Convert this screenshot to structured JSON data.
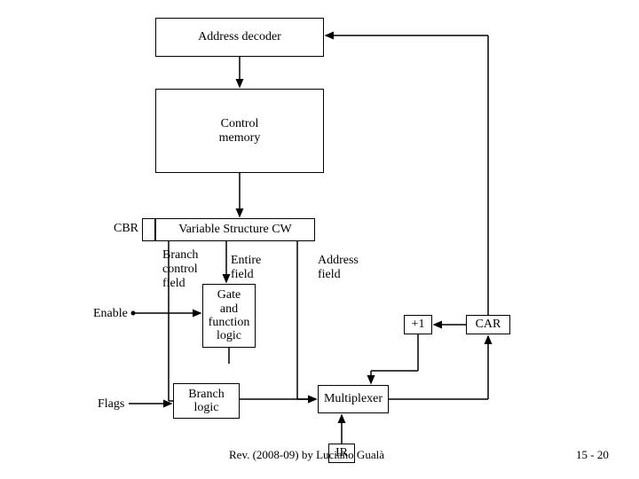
{
  "boxes": {
    "addressDecoder": "Address decoder",
    "controlMemoryLine1": "Control",
    "controlMemoryLine2": "memory",
    "variableStructure": "Variable Structure CW",
    "branchControlLine1": "Branch",
    "branchControlLine2": "control",
    "branchControlLine3": "field",
    "entireFieldLine1": "Entire",
    "entireFieldLine2": "field",
    "gateLogicLine1": "Gate",
    "gateLogicLine2": "and",
    "gateLogicLine3": "function",
    "gateLogicLine4": "logic",
    "branchLogicLine1": "Branch",
    "branchLogicLine2": "logic",
    "multiplexer": "Multiplexer",
    "plusOne": "+1",
    "car": "CAR",
    "ir": "IR"
  },
  "labels": {
    "cbr": "CBR",
    "enable": "Enable",
    "flags": "Flags",
    "addressField": "Address",
    "addressFieldLine2": "field"
  },
  "footer": {
    "credit": "Rev. (2008-09) by Luciano Gualà",
    "page": "15 - 20"
  }
}
